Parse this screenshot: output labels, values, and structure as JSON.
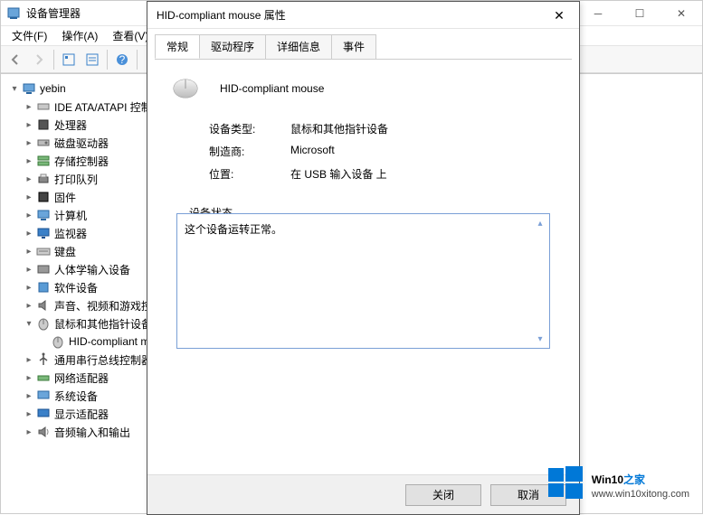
{
  "dm": {
    "title": "设备管理器",
    "menu": [
      "文件(F)",
      "操作(A)",
      "查看(V)"
    ],
    "root": "yebin",
    "nodes": [
      {
        "label": "IDE ATA/ATAPI 控制器",
        "icon": "ide-icon"
      },
      {
        "label": "处理器",
        "icon": "cpu-icon"
      },
      {
        "label": "磁盘驱动器",
        "icon": "disk-icon"
      },
      {
        "label": "存储控制器",
        "icon": "storage-icon"
      },
      {
        "label": "打印队列",
        "icon": "printer-icon"
      },
      {
        "label": "固件",
        "icon": "firmware-icon"
      },
      {
        "label": "计算机",
        "icon": "computer-icon"
      },
      {
        "label": "监视器",
        "icon": "monitor-icon"
      },
      {
        "label": "键盘",
        "icon": "keyboard-icon"
      },
      {
        "label": "人体学输入设备",
        "icon": "hid-icon"
      },
      {
        "label": "软件设备",
        "icon": "software-icon"
      },
      {
        "label": "声音、视频和游戏控制器",
        "icon": "sound-icon"
      },
      {
        "label": "鼠标和其他指针设备",
        "icon": "mouse-category-icon",
        "expanded": true,
        "child": "HID-compliant mouse"
      },
      {
        "label": "通用串行总线控制器",
        "icon": "usb-icon"
      },
      {
        "label": "网络适配器",
        "icon": "network-icon"
      },
      {
        "label": "系统设备",
        "icon": "system-icon"
      },
      {
        "label": "显示适配器",
        "icon": "display-icon"
      },
      {
        "label": "音频输入和输出",
        "icon": "audio-icon"
      }
    ]
  },
  "dlg": {
    "title": "HID-compliant mouse 属性",
    "tabs": [
      "常规",
      "驱动程序",
      "详细信息",
      "事件"
    ],
    "active_tab": 0,
    "device_name": "HID-compliant mouse",
    "rows": {
      "type_label": "设备类型:",
      "type_value": "鼠标和其他指针设备",
      "mfr_label": "制造商:",
      "mfr_value": "Microsoft",
      "loc_label": "位置:",
      "loc_value": "在 USB 输入设备 上"
    },
    "status_label": "设备状态",
    "status_text": "这个设备运转正常。",
    "close_btn": "关闭",
    "cancel_btn": "取消"
  },
  "watermark": {
    "brand": "Win10",
    "suffix": "之家",
    "url": "www.win10xitong.com"
  }
}
